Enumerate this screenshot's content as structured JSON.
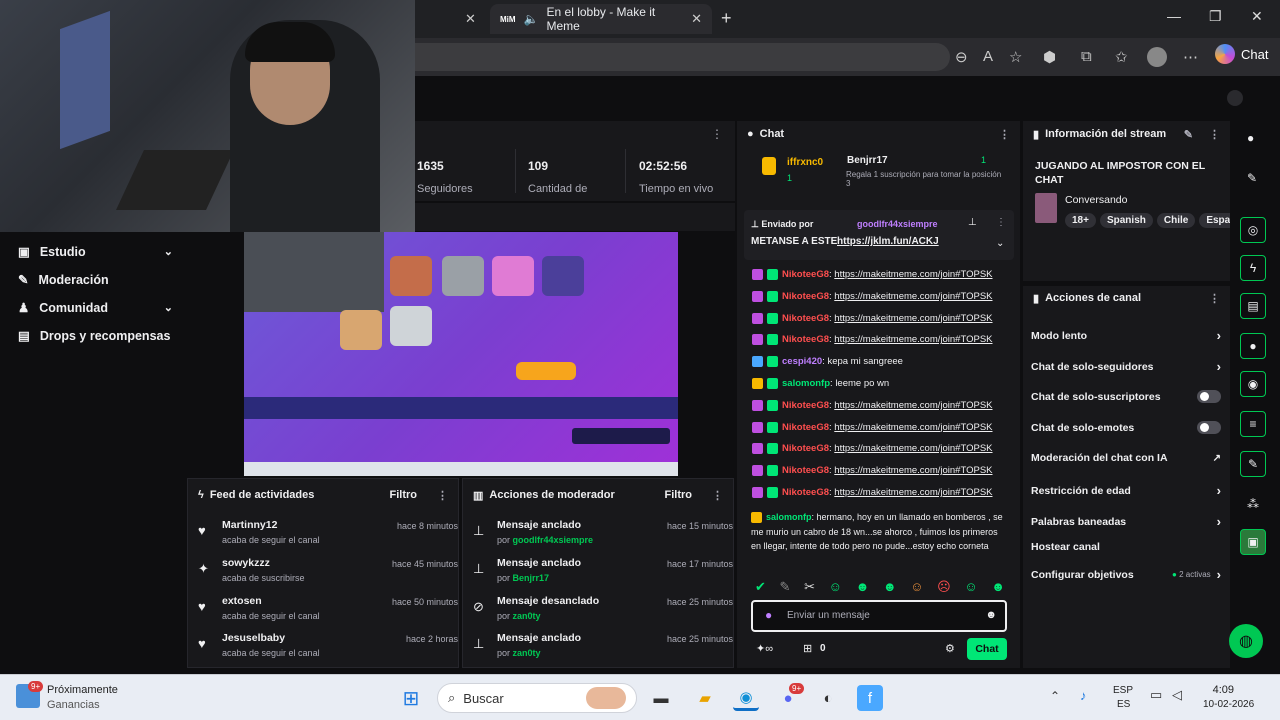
{
  "browser": {
    "tab_title": "En el lobby - Make it Meme",
    "tab_badge": "MiM",
    "chat_button": "Chat"
  },
  "stats": [
    {
      "value": "1635",
      "label": "Seguidores"
    },
    {
      "value": "109",
      "label": "Cantidad de"
    },
    {
      "value": "02:52:56",
      "label": "Tiempo en vivo"
    }
  ],
  "nav": [
    {
      "label": "Estudio",
      "icon": "camera-icon",
      "chevron": true
    },
    {
      "label": "Moderación",
      "icon": "wrench-icon",
      "chevron": false
    },
    {
      "label": "Comunidad",
      "icon": "community-icon",
      "chevron": true
    },
    {
      "label": "Drops y recompensas",
      "icon": "gift-icon",
      "chevron": false
    }
  ],
  "feed": {
    "title": "Feed de actividades",
    "filter": "Filtro",
    "items": [
      {
        "name": "Martinny12",
        "sub": "acaba de seguir el canal",
        "time": "hace 8 minutos",
        "icon": "heart-icon"
      },
      {
        "name": "sowykzzz",
        "sub": "acaba de suscribirse",
        "time": "hace 45 minutos",
        "icon": "star-icon"
      },
      {
        "name": "extosen",
        "sub": "acaba de seguir el canal",
        "time": "hace 50 minutos",
        "icon": "heart-icon"
      },
      {
        "name": "Jesuselbaby",
        "sub": "acaba de seguir el canal",
        "time": "hace 2 horas",
        "icon": "heart-icon"
      }
    ]
  },
  "modactions": {
    "title": "Acciones de moderador",
    "filter": "Filtro",
    "items": [
      {
        "name": "Mensaje anclado",
        "by": "por",
        "user": "goodlfr44xsiempre",
        "time": "hace 15 minutos",
        "icon": "pin-icon"
      },
      {
        "name": "Mensaje anclado",
        "by": "por",
        "user": "Benjrr17",
        "time": "hace 17 minutos",
        "icon": "pin-icon"
      },
      {
        "name": "Mensaje desanclado",
        "by": "por",
        "user": "zan0ty",
        "time": "hace 25 minutos",
        "icon": "unpin-icon"
      },
      {
        "name": "Mensaje anclado",
        "by": "por",
        "user": "zan0ty",
        "time": "hace 25 minutos",
        "icon": "pin-icon"
      }
    ]
  },
  "chat": {
    "title": "Chat",
    "gift": {
      "user1": "iffrxnc0",
      "user1_count": "1",
      "user2": "Benjrr17",
      "user2_count": "1",
      "text": "Regala 1 suscripción para tomar la posición 3"
    },
    "pinned": {
      "sent_by": "Enviado por",
      "user": "goodlfr44xsiempre",
      "text": "METANSE A ESTE",
      "link": "https://jklm.fun/ACKJ"
    },
    "messages": [
      {
        "user": "NikoteeG8",
        "color": "#ff4f4f",
        "text": "https://makeitmeme.com/join#TOPSK",
        "link": true
      },
      {
        "user": "NikoteeG8",
        "color": "#ff4f4f",
        "text": "https://makeitmeme.com/join#TOPSK",
        "link": true
      },
      {
        "user": "NikoteeG8",
        "color": "#ff4f4f",
        "text": "https://makeitmeme.com/join#TOPSK",
        "link": true
      },
      {
        "user": "NikoteeG8",
        "color": "#ff4f4f",
        "text": "https://makeitmeme.com/join#TOPSK",
        "link": true
      },
      {
        "user": "cespi420",
        "color": "#bf7fff",
        "text": "kepa mi sangreee",
        "link": false
      },
      {
        "user": "salomonfp",
        "color": "#00e676",
        "text": "leeme po wn",
        "link": false
      },
      {
        "user": "NikoteeG8",
        "color": "#ff4f4f",
        "text": "https://makeitmeme.com/join#TOPSK",
        "link": true
      },
      {
        "user": "NikoteeG8",
        "color": "#ff4f4f",
        "text": "https://makeitmeme.com/join#TOPSK",
        "link": true
      },
      {
        "user": "NikoteeG8",
        "color": "#ff4f4f",
        "text": "https://makeitmeme.com/join#TOPSK",
        "link": true
      },
      {
        "user": "NikoteeG8",
        "color": "#ff4f4f",
        "text": "https://makeitmeme.com/join#TOPSK",
        "link": true
      },
      {
        "user": "NikoteeG8",
        "color": "#ff4f4f",
        "text": "https://makeitmeme.com/join#TOPSK",
        "link": true
      }
    ],
    "long_message": {
      "user": "salomonfp",
      "text": "hermano, hoy en un llamado en bomberos , se me murio un cabro de 18 wn...se ahorco , fuimos los primeros en llegar, intente de todo pero no pude...estoy echo corneta"
    },
    "input_placeholder": "Enviar un mensaje",
    "points": "0",
    "send_label": "Chat"
  },
  "stream_info": {
    "title": "Información del stream",
    "stream_title": "JUGANDO AL IMPOSTOR CON EL CHAT",
    "category": "Conversando",
    "tags": [
      "18+",
      "Spanish",
      "Chile",
      "Espa"
    ]
  },
  "channel_actions": {
    "title": "Acciones de canal",
    "items": [
      {
        "label": "Modo lento",
        "control": "chevron"
      },
      {
        "label": "Chat de solo-seguidores",
        "control": "chevron"
      },
      {
        "label": "Chat de solo-suscriptores",
        "control": "toggle"
      },
      {
        "label": "Chat de solo-emotes",
        "control": "toggle"
      },
      {
        "label": "Moderación del chat con IA",
        "control": "external"
      },
      {
        "label": "Restricción de edad",
        "control": "chevron"
      },
      {
        "label": "Palabras baneadas",
        "control": "chevron"
      },
      {
        "label": "Hostear canal",
        "control": "none"
      },
      {
        "label": "Configurar objetivos",
        "control": "chevron",
        "extra": "2 activas"
      }
    ]
  },
  "taskbar": {
    "weather_title": "Próximamente",
    "weather_sub": "Ganancias",
    "weather_badge": "9+",
    "search_placeholder": "Buscar",
    "discord_badge": "9+",
    "lang1": "ESP",
    "lang2": "ES",
    "time": "4:09",
    "date": "10-02-2026"
  },
  "colors": {
    "accent": "#00e676",
    "bg": "#0e0e10",
    "panel": "#18181b"
  }
}
